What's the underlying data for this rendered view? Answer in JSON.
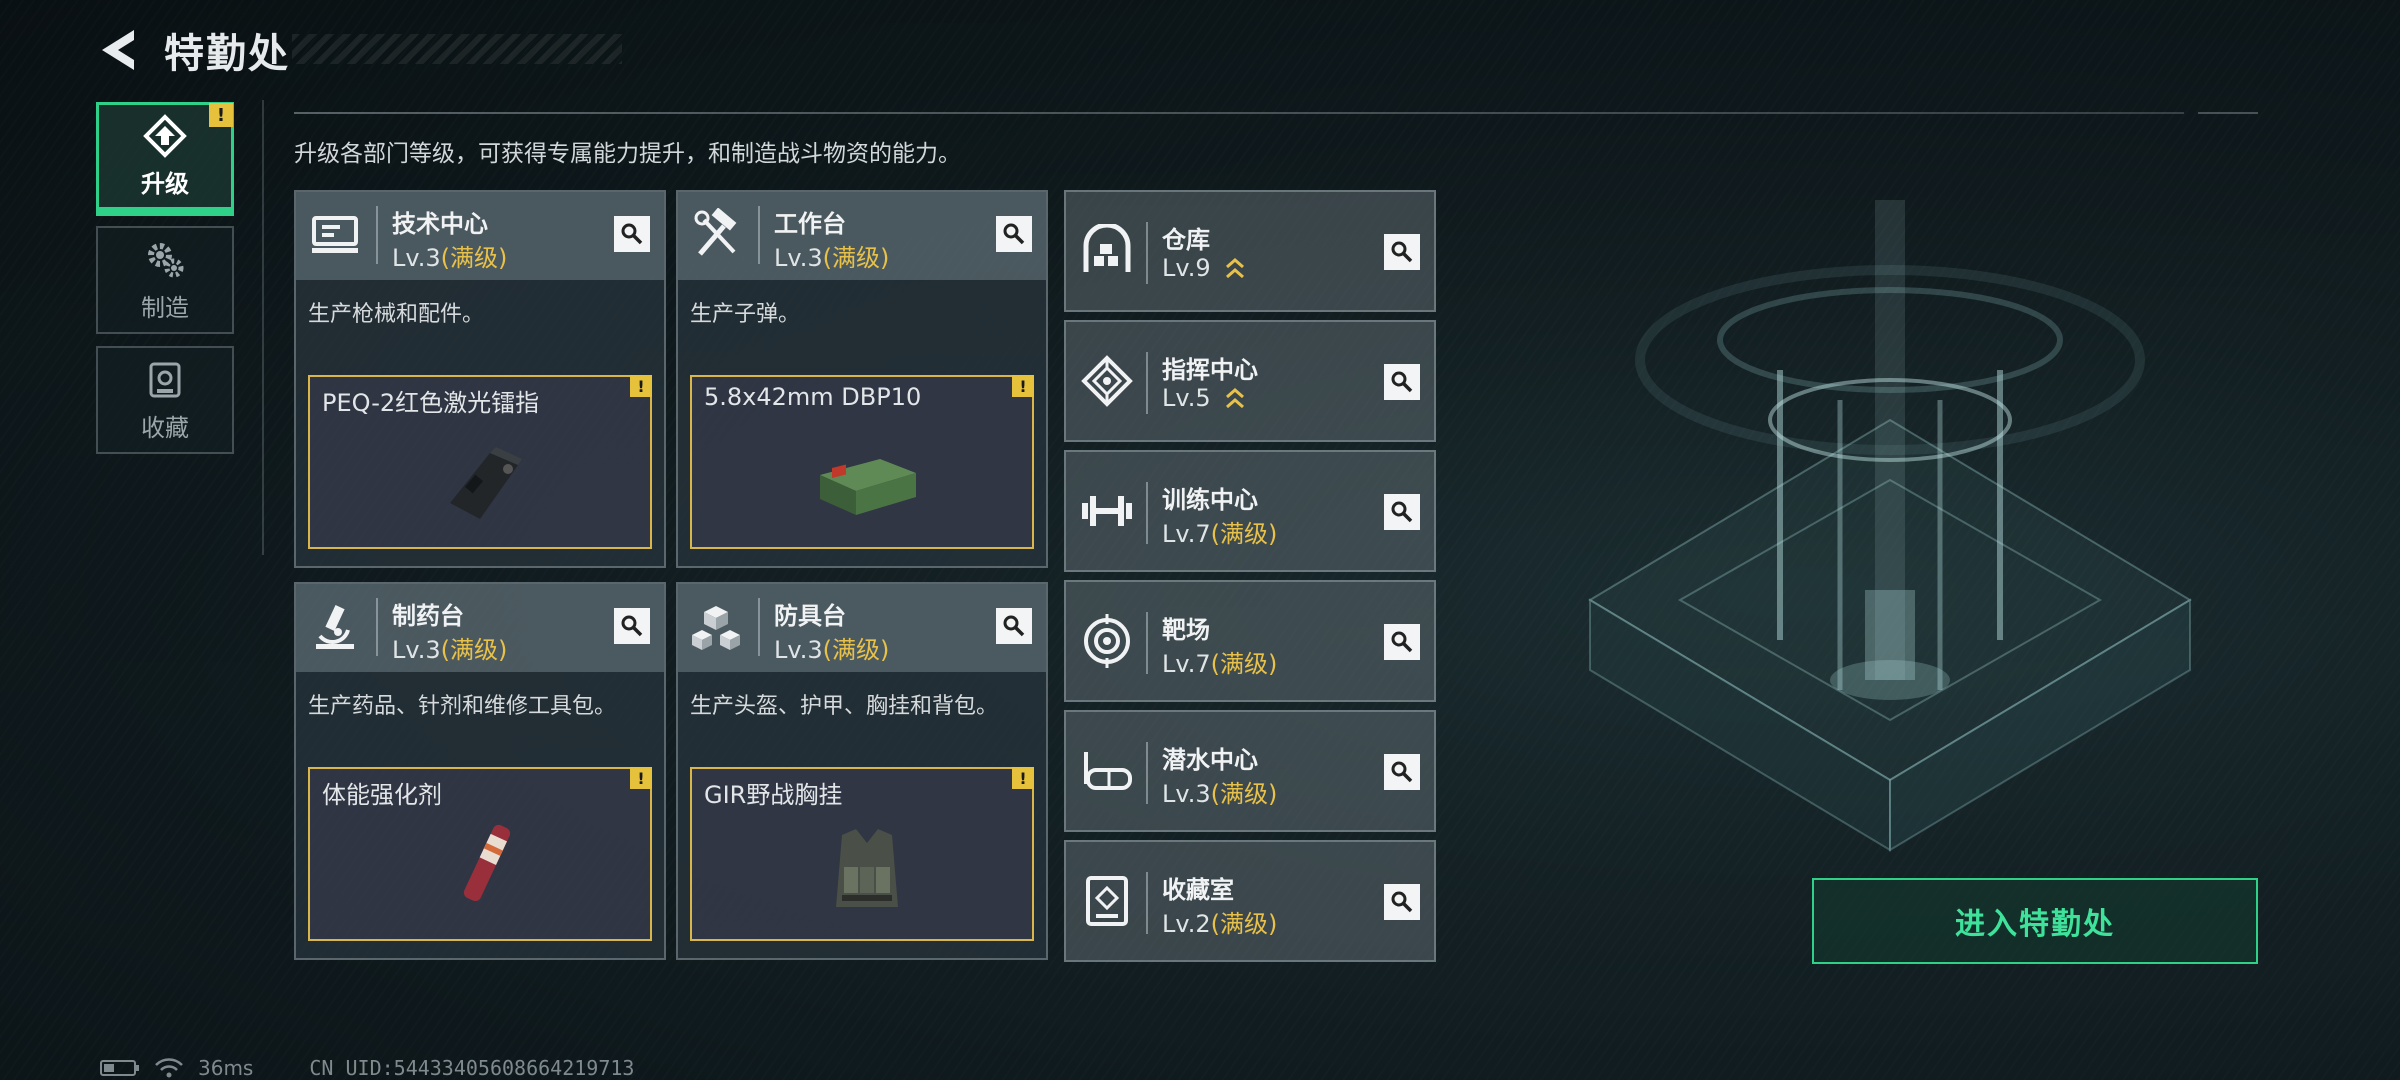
{
  "header": {
    "title": "特勤处"
  },
  "tabs": [
    {
      "label": "升级",
      "icon": "upgrade-icon",
      "active": true,
      "alert": "!"
    },
    {
      "label": "制造",
      "icon": "gears-icon",
      "active": false
    },
    {
      "label": "收藏",
      "icon": "collection-icon",
      "active": false
    }
  ],
  "description": "升级各部门等级，可获得专属能力提升，和制造战斗物资的能力。",
  "max_label": "(满级)",
  "cards": [
    {
      "name": "技术中心",
      "level": "Lv.3",
      "desc": "生产枪械和配件。",
      "item": "PEQ-2红色激光镭指",
      "icon": "computer-icon",
      "alert": "!"
    },
    {
      "name": "工作台",
      "level": "Lv.3",
      "desc": "生产子弹。",
      "item": "5.8x42mm DBP10",
      "icon": "hammer-wrench-icon",
      "alert": "!"
    },
    {
      "name": "制药台",
      "level": "Lv.3",
      "desc": "生产药品、针剂和维修工具包。",
      "item": "体能强化剂",
      "icon": "microscope-icon",
      "alert": "!"
    },
    {
      "name": "防具台",
      "level": "Lv.3",
      "desc": "生产头盔、护甲、胸挂和背包。",
      "item": "GIR野战胸挂",
      "icon": "cubes-icon",
      "alert": "!"
    }
  ],
  "facilities": [
    {
      "name": "仓库",
      "level": "Lv.9",
      "status": "",
      "icon": "warehouse-icon",
      "upgradable": true
    },
    {
      "name": "指挥中心",
      "level": "Lv.5",
      "status": "",
      "icon": "command-icon",
      "upgradable": true
    },
    {
      "name": "训练中心",
      "level": "Lv.7",
      "status": "(满级)",
      "icon": "dumbbell-icon",
      "upgradable": false
    },
    {
      "name": "靶场",
      "level": "Lv.7",
      "status": "(满级)",
      "icon": "target-icon",
      "upgradable": false
    },
    {
      "name": "潜水中心",
      "level": "Lv.3",
      "status": "(满级)",
      "icon": "diving-mask-icon",
      "upgradable": false
    },
    {
      "name": "收藏室",
      "level": "Lv.2",
      "status": "(满级)",
      "icon": "vault-icon",
      "upgradable": false
    }
  ],
  "enter_button": "进入特勤处",
  "footer": {
    "ping": "36ms",
    "uid": "CN UID:5443340560866421971З"
  },
  "colors": {
    "accent": "#2fd088",
    "max_level": "#e8c14a",
    "alert": "#e6c23c"
  }
}
